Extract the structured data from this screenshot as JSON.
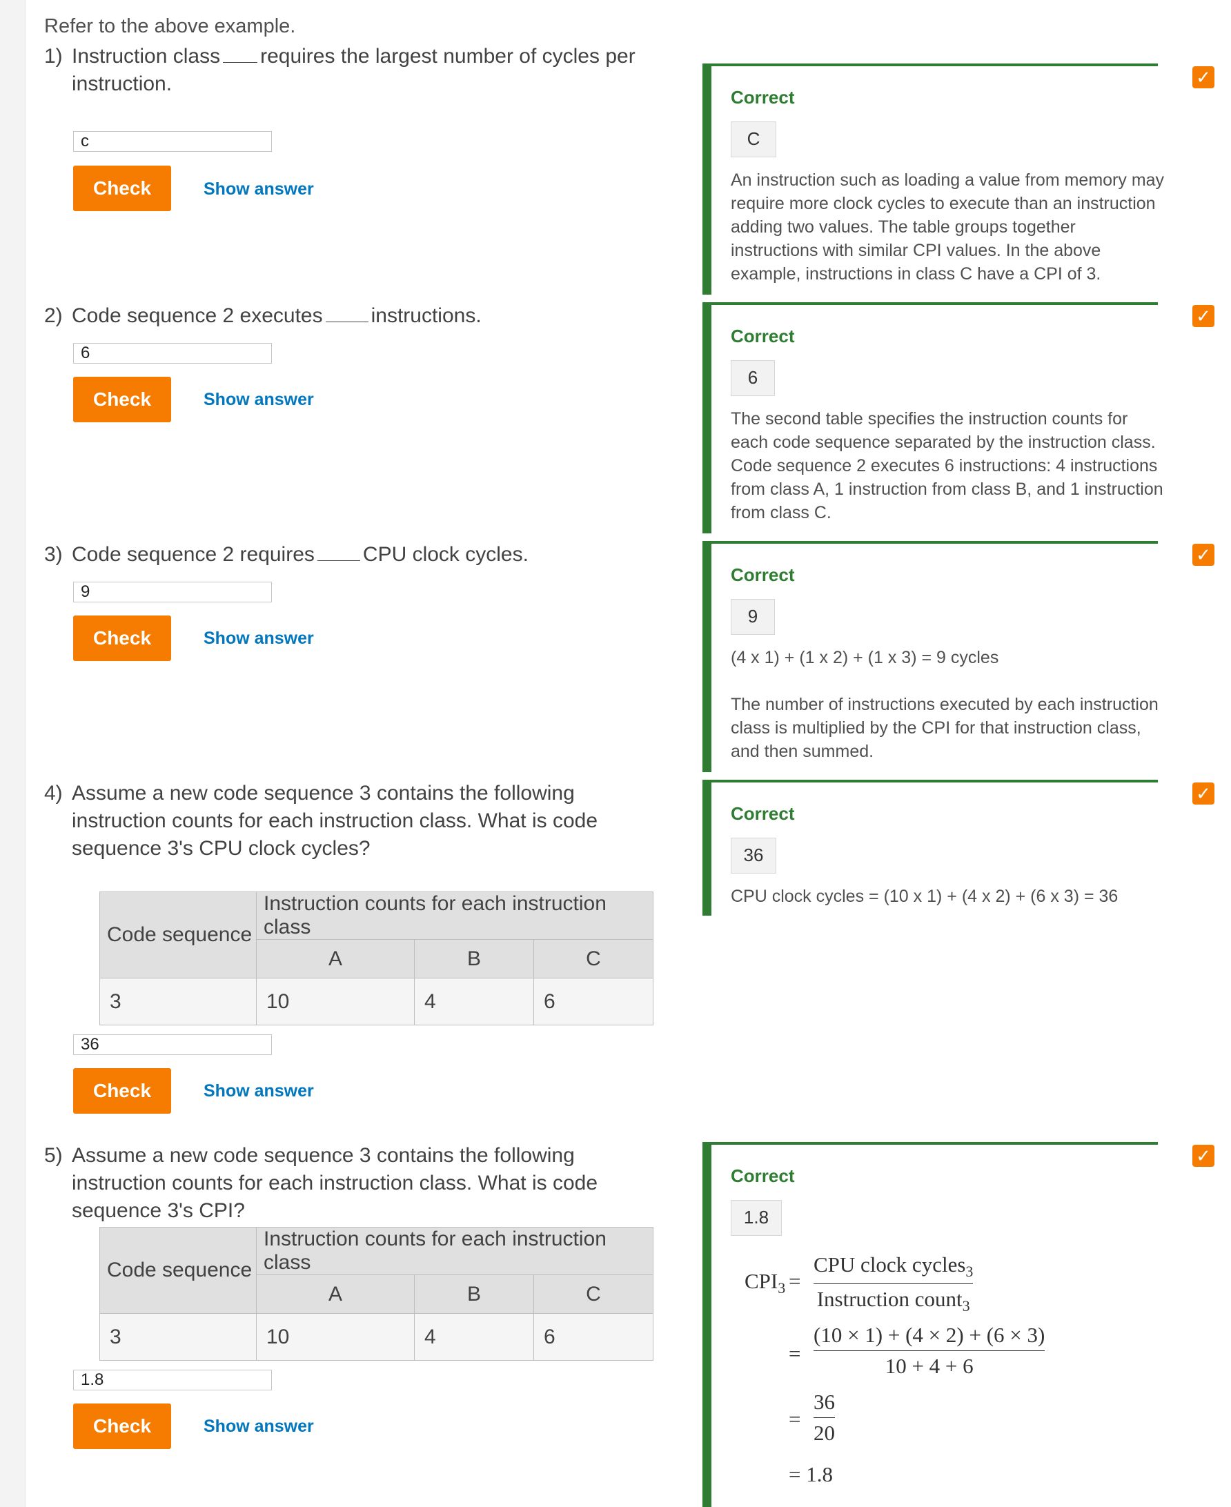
{
  "intro": "Refer to the above example.",
  "check_label": "Check",
  "show_answer_label": "Show answer",
  "correct_label": "Correct",
  "questions": [
    {
      "num": "1)",
      "text_a": "Instruction class",
      "text_b": "requires the largest number of cycles per",
      "text_c": "instruction.",
      "input": "c",
      "answer": "C",
      "explanation": "An instruction such as loading a value from memory may require more clock cycles to execute than an instruction adding two values. The table groups together instructions with similar CPI values. In the above example, instructions in class C have a CPI of 3."
    },
    {
      "num": "2)",
      "text_a": "Code sequence 2 executes",
      "text_b": "instructions.",
      "input": "6",
      "answer": "6",
      "explanation": "The second table specifies the instruction counts for each code sequence separated by the instruction class. Code sequence 2 executes 6 instructions: 4 instructions from class A, 1 instruction from class B, and 1 instruction from class C."
    },
    {
      "num": "3)",
      "text_a": "Code sequence 2 requires",
      "text_b": "CPU clock cycles.",
      "input": "9",
      "answer": "9",
      "explanation_line1": "(4 x 1) + (1 x 2) + (1 x 3) = 9 cycles",
      "explanation_line2": "The number of instructions executed by each instruction class is multiplied by the CPI for that instruction class, and then summed."
    },
    {
      "num": "4)",
      "text": "Assume a new code sequence 3 contains the following instruction counts for each instruction class. What is code sequence 3's CPU clock cycles?",
      "input": "36",
      "answer": "36",
      "explanation": "CPU clock cycles = (10 x 1) + (4 x 2) + (6 x 3) = 36"
    },
    {
      "num": "5)",
      "text": "Assume a new code sequence 3 contains the following instruction counts for each instruction class. What is code sequence 3's CPI?",
      "input": "1.8",
      "answer": "1.8"
    }
  ],
  "table": {
    "col_header": "Code sequence",
    "group_header": "Instruction counts for each instruction class",
    "classes": [
      "A",
      "B",
      "C"
    ],
    "row": [
      "3",
      "10",
      "4",
      "6"
    ]
  },
  "formula": {
    "lhs": "CPI",
    "lhs_sub": "3",
    "eq": "=",
    "f1_num": "CPU clock cycles",
    "f1_num_sub": "3",
    "f1_den": "Instruction count",
    "f1_den_sub": "3",
    "f2_num": "(10 × 1) + (4 × 2) + (6 × 3)",
    "f2_den": "10 + 4 + 6",
    "f3_num": "36",
    "f3_den": "20",
    "result": "= 1.8"
  },
  "colors": {
    "accent": "#f57c00",
    "link": "#0277bd",
    "correct": "#2e7d32"
  },
  "icons": {
    "check": "checkmark-icon"
  }
}
